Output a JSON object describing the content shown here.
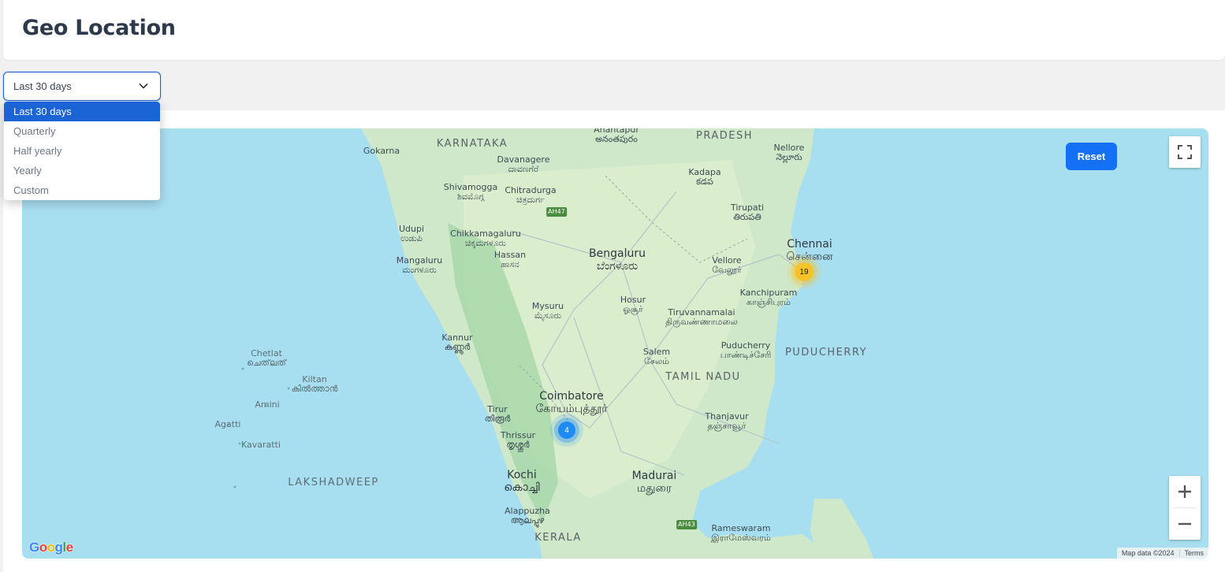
{
  "header": {
    "title": "Geo Location"
  },
  "filter": {
    "selected": "Last 30 days",
    "options": [
      "Last 30 days",
      "Quarterly",
      "Half yearly",
      "Yearly",
      "Custom"
    ]
  },
  "map": {
    "reset_label": "Reset",
    "attribution": "Map data ©2024",
    "terms": "Terms",
    "logo": "Google",
    "clusters": [
      {
        "count": "19",
        "color": "#f6c32a"
      },
      {
        "count": "4",
        "color": "#1d8af5"
      }
    ],
    "labels": {
      "karnataka": "KARNATAKA",
      "pradesh": "PRADESH",
      "tamilnadu": "TAMIL NADU",
      "kerala": "KERALA",
      "puducherry_region": "PUDUCHERRY",
      "lakshadweep": "LAKSHADWEEP",
      "bengaluru": "Bengaluru",
      "bengaluru_local": "ಬೆಂಗಳೂರು",
      "chennai": "Chennai",
      "chennai_local": "சென்னை",
      "coimbatore": "Coimbatore",
      "coimbatore_local": "கோயம்புத்தூர்",
      "madurai": "Madurai",
      "madurai_local": "மதுரை",
      "kochi": "Kochi",
      "kochi_local": "കൊച്ചി",
      "mysuru": "Mysuru",
      "mysuru_local": "ಮೈಸೂರು",
      "mangaluru": "Mangaluru",
      "mangaluru_local": "ಮಂಗಳೂರು",
      "udupi": "Udupi",
      "udupi_local": "ಉಡುಪಿ",
      "kannur": "Kannur",
      "kannur_local": "കണ്ണൂർ",
      "salem": "Salem",
      "salem_local": "சேலம்",
      "vellore": "Vellore",
      "vellore_local": "வேலூர்",
      "hosur": "Hosur",
      "hosur_local": "ஓசூர்",
      "thanjavur": "Thanjavur",
      "thanjavur_local": "தஞ்சாவூர்",
      "thrissur": "Thrissur",
      "thrissur_local": "തൃശ്ശൂർ",
      "puducherry": "Puducherry",
      "puducherry_local": "பாண்டிச்சேரி",
      "tiruvannamalai": "Tiruvannamalai",
      "tiruvannamalai_local": "திருவண்ணாமலை",
      "kanchipuram": "Kanchipuram",
      "kanchipuram_local": "காஞ்சிபுரம்",
      "tirupati": "Tirupati",
      "tirupati_local": "తిరుపతి",
      "kadapa": "Kadapa",
      "kadapa_local": "కడప",
      "nellore": "Nellore",
      "nellore_local": "నెల్లూరు",
      "anantapur": "Anantapur",
      "anantapur_local": "అనంతపురం",
      "davanagere": "Davanagere",
      "davanagere_local": "ದಾವಣಗೆರೆ",
      "shivamogga": "Shivamogga",
      "shivamogga_local": "ಶಿವಮೊಗ್ಗ",
      "chitradurga": "Chitradurga",
      "chitradurga_local": "ಚಿತ್ರದುರ್ಗ",
      "chikkamagaluru": "Chikkamagaluru",
      "chikkamagaluru_local": "ಚಿಕ್ಕಮಗಳೂರು",
      "hassan": "Hassan",
      "hassan_local": "ಹಾಸನ",
      "gokarna": "Gokarna",
      "tirur": "Tirur",
      "tirur_local": "തിരൂർ",
      "alappuzha": "Alappuzha",
      "alappuzha_local": "ആലപ്പുഴ",
      "rameswaram": "Rameswaram",
      "rameswaram_local": "இராமேஸ்வரம்",
      "chetlat": "Chetlat",
      "chetlat_local": "ചെത്‌ലത്",
      "kiltan": "Kiltan",
      "kiltan_local": "കിൽത്താൻ",
      "amini": "Amini",
      "agatti": "Agatti",
      "kavaratti": "Kavaratti",
      "ah47": "AH47",
      "ah43": "AH43"
    }
  }
}
